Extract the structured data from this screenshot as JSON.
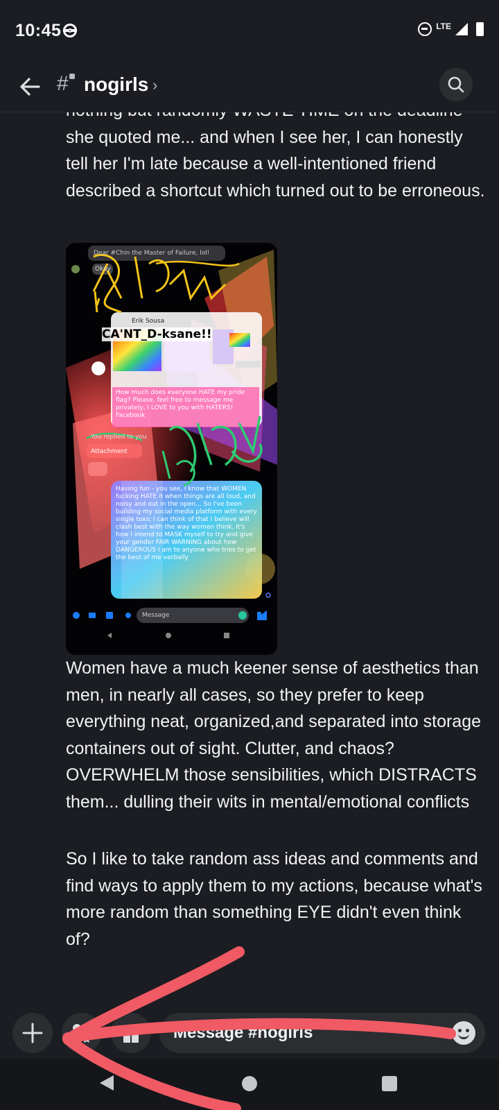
{
  "status_bar": {
    "time": "10:45",
    "network": "LTE",
    "icons": [
      "pokeball-icon",
      "dnd-icon",
      "signal-icon",
      "battery-icon"
    ]
  },
  "header": {
    "channel_name": "nogirls",
    "back_icon": "arrow-left-icon",
    "channel_icon": "locked-hash-icon",
    "search_icon": "search-icon"
  },
  "messages": {
    "text_1": "nothing but randomly WASTE TIME on the deadline she quoted me... and when I see her, I can honestly tell her I'm late because a well-intentioned friend described a shortcut which turned out to be erroneous.",
    "text_2": "Women have a much keener sense of aesthetics than men, in nearly all cases, so they prefer to keep everything neat, organized,and separated into storage containers out of sight. Clutter, and chaos? OVERWHELM those sensibilities, which DISTRACTS them... dulling their wits in mental/emotional conflicts",
    "text_3": "So I like to take random ass ideas and comments and find ways to apply them to my actions, because what's more random than something EYE didn't even think of?"
  },
  "attachment": {
    "top_bubble": "Dear #Chin the Master of Failure, lol!",
    "top_bubble_2": "Okay",
    "sender": "Erik Sousa",
    "overlay_caption": "CA'NT_D-ksane!!",
    "pride_text": "How much does everyone HATE my pride flag? Please, feel free to message me privately, I LOVE to you with HATERS! Facebook",
    "reply_label": "You replied to you",
    "attachment_label": "Attachment",
    "long_text": "Having fun - you see, I know that WOMEN fucking HATE it when things are all loud, and noisy and out in the open... So I've been building my social media platform with every single toxic I can think of that I believe will clash best with the way women think, it's how I intend to MASK myself to try and give your gender FAIR WARNING about how DANGEROUS I am to anyone who tries to get the best of me verbally",
    "input_placeholder": "Message"
  },
  "composer": {
    "placeholder": "Message #nogirls",
    "plus_icon": "plus-icon",
    "apps_icon": "apps-icon",
    "gift_icon": "gift-icon",
    "emoji_icon": "emoji-icon"
  },
  "nav_bar": {
    "icons": [
      "nav-back-icon",
      "nav-home-icon",
      "nav-recents-icon"
    ]
  },
  "colors": {
    "background": "#1c1d22",
    "surface": "#2b2d31",
    "text": "#f2f3f5",
    "muted": "#b5bac1",
    "annotation_red": "#f05a64",
    "scribble_yellow": "#f5c518",
    "scribble_green": "#2ecc71"
  }
}
